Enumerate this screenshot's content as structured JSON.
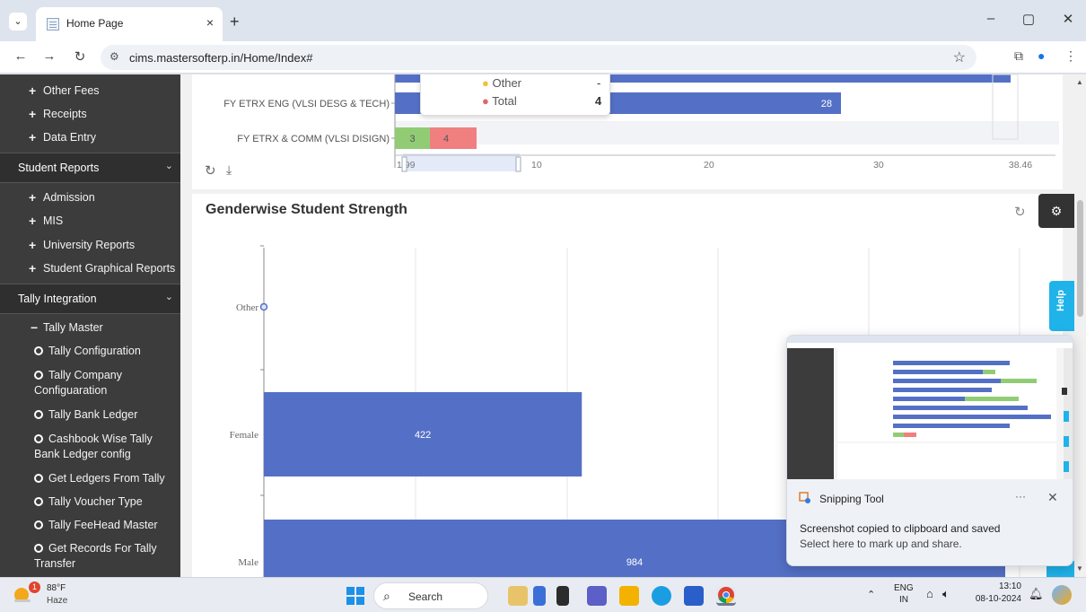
{
  "browser": {
    "tab_title": "Home Page",
    "tab_close": "×",
    "new_tab": "+",
    "tab_dropdown": "⌄",
    "url": "cims.mastersofterp.in/Home/Index#",
    "win_minimize": "–",
    "win_restore": "▢",
    "win_close": "✕"
  },
  "sidebar": {
    "top_items": [
      {
        "label": "Other Fees"
      },
      {
        "label": "Receipts"
      },
      {
        "label": "Data Entry"
      }
    ],
    "student_reports": {
      "header": "Student Reports",
      "items": [
        {
          "label": "Admission"
        },
        {
          "label": "MIS"
        },
        {
          "label": "University Reports"
        },
        {
          "label": "Student Graphical Reports"
        }
      ]
    },
    "tally_integration": {
      "header": "Tally Integration",
      "group": "Tally Master",
      "items": [
        {
          "label": "Tally Configuration"
        },
        {
          "label": "Tally Company Configuaration"
        },
        {
          "label": "Tally Bank Ledger"
        },
        {
          "label": "Cashbook Wise Tally Bank Ledger config"
        },
        {
          "label": "Get Ledgers From Tally"
        },
        {
          "label": "Tally Voucher Type"
        },
        {
          "label": "Tally FeeHead Master"
        },
        {
          "label": "Get Records For Tally Transfer"
        }
      ]
    }
  },
  "top_chart": {
    "tooltip": {
      "rows": [
        {
          "label": "Other",
          "value": "-",
          "color": "#f1c232"
        },
        {
          "label": "Total",
          "value": "4",
          "color": "#e06666"
        }
      ]
    }
  },
  "gender_chart": {
    "title": "Genderwise Student Strength"
  },
  "chart_data": [
    {
      "type": "bar",
      "orientation": "horizontal",
      "categories": [
        "FY ETRX ENG (VLSI DESG & TECH)",
        "FY ETRX & COMM (VLSI DISIGN)"
      ],
      "series": [
        {
          "values": [
            28,
            null
          ],
          "color": "#5470c6"
        },
        {
          "values": [
            null,
            3
          ],
          "color": "#91cc75"
        },
        {
          "values": [
            null,
            4
          ],
          "color": "#f08080"
        }
      ],
      "navigator_ticks": [
        "1.99",
        "10",
        "20",
        "30",
        "38.46"
      ]
    },
    {
      "type": "bar",
      "orientation": "horizontal",
      "title": "Genderwise Student Strength",
      "categories": [
        "Other",
        "Female",
        "Male"
      ],
      "values": [
        0,
        422,
        984
      ],
      "color": "#5470c6"
    }
  ],
  "help": {
    "label": "Help"
  },
  "toast": {
    "app": "Snipping Tool",
    "more": "···",
    "close": "✕",
    "line1": "Screenshot copied to clipboard and saved",
    "line2": "Select here to mark up and share."
  },
  "taskbar": {
    "weather_badge": "1",
    "temperature": "88°F",
    "condition": "Haze",
    "search": "Search",
    "lang": "ENG",
    "region": "IN",
    "time": "13:10",
    "date": "08-10-2024"
  }
}
